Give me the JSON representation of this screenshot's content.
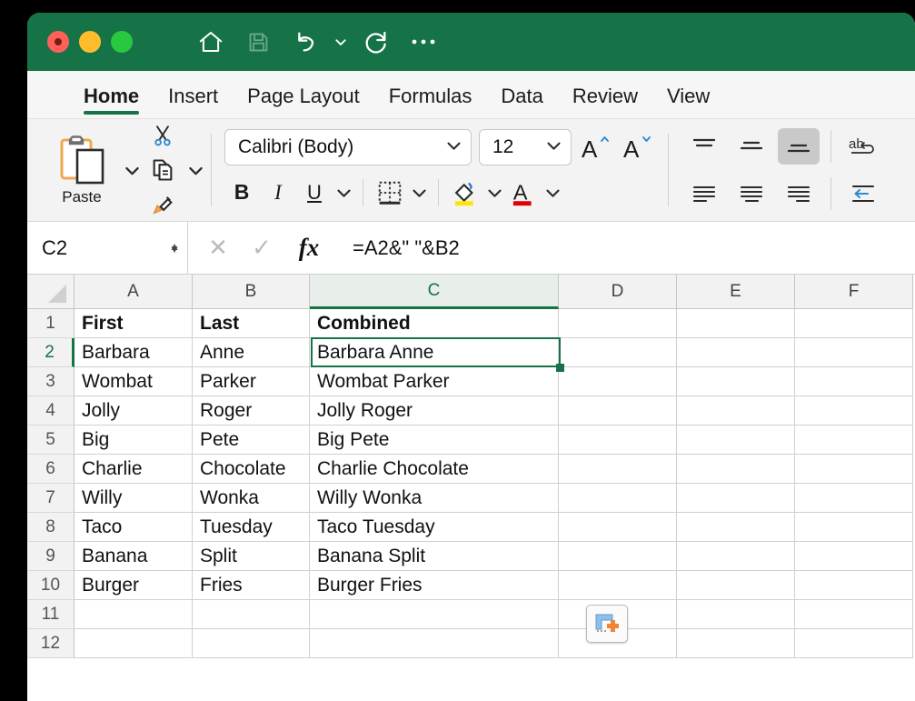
{
  "window": {
    "titlebar_color": "#157347",
    "traffic_lights": [
      "close",
      "minimize",
      "maximize"
    ],
    "quick_access": [
      {
        "name": "home-icon",
        "label": "Home"
      },
      {
        "name": "save-icon",
        "label": "Save"
      },
      {
        "name": "undo-icon",
        "label": "Undo"
      },
      {
        "name": "undo-dropdown-icon",
        "label": "Undo options"
      },
      {
        "name": "redo-icon",
        "label": "Redo"
      },
      {
        "name": "more-options-icon",
        "label": "More"
      }
    ]
  },
  "ribbon": {
    "tabs": [
      {
        "label": "Home",
        "active": true
      },
      {
        "label": "Insert",
        "active": false
      },
      {
        "label": "Page Layout",
        "active": false
      },
      {
        "label": "Formulas",
        "active": false
      },
      {
        "label": "Data",
        "active": false
      },
      {
        "label": "Review",
        "active": false
      },
      {
        "label": "View",
        "active": false
      }
    ],
    "clipboard": {
      "paste_label": "Paste",
      "cut_label": "Cut",
      "copy_label": "Copy",
      "format_painter_label": "Format Painter"
    },
    "font": {
      "family_value": "Calibri (Body)",
      "size_value": "12",
      "bold_label": "B",
      "italic_label": "I",
      "underline_label": "U",
      "grow_font_label": "A",
      "shrink_font_label": "A",
      "borders_label": "Borders",
      "fill_color_label": "Fill Color",
      "fill_color": "#ffe600",
      "font_color_label": "Font Color",
      "font_color": "#e00000"
    },
    "alignment": {
      "top_align_label": "Top Align",
      "middle_align_label": "Middle Align",
      "bottom_align_label": "Bottom Align",
      "bottom_align_selected": true,
      "align_left_label": "Align Left",
      "align_center_label": "Center",
      "align_right_label": "Align Right",
      "wrap_text_label": "Wrap Text",
      "decrease_indent_label": "Decrease Indent"
    }
  },
  "formula_bar": {
    "name_box_value": "C2",
    "cancel_label": "✕",
    "enter_label": "✓",
    "fx_label": "fx",
    "formula_value": "=A2&\" \"&B2"
  },
  "sheet": {
    "column_headers": [
      "A",
      "B",
      "C",
      "D",
      "E",
      "F"
    ],
    "selected_column": "C",
    "row_headers": [
      "1",
      "2",
      "3",
      "4",
      "5",
      "6",
      "7",
      "8",
      "9",
      "10",
      "11",
      "12"
    ],
    "selected_row": "2",
    "selected_cell": "C2",
    "quick_analysis_label": "Paste Options",
    "rows": [
      {
        "num": "1",
        "bold": true,
        "cells": [
          "First",
          "Last",
          "Combined",
          "",
          "",
          ""
        ]
      },
      {
        "num": "2",
        "bold": false,
        "cells": [
          "Barbara",
          "Anne",
          "Barbara Anne",
          "",
          "",
          ""
        ]
      },
      {
        "num": "3",
        "bold": false,
        "cells": [
          "Wombat",
          "Parker",
          "Wombat Parker",
          "",
          "",
          ""
        ]
      },
      {
        "num": "4",
        "bold": false,
        "cells": [
          "Jolly",
          "Roger",
          "Jolly Roger",
          "",
          "",
          ""
        ]
      },
      {
        "num": "5",
        "bold": false,
        "cells": [
          "Big",
          "Pete",
          "Big Pete",
          "",
          "",
          ""
        ]
      },
      {
        "num": "6",
        "bold": false,
        "cells": [
          "Charlie",
          "Chocolate",
          "Charlie Chocolate",
          "",
          "",
          ""
        ]
      },
      {
        "num": "7",
        "bold": false,
        "cells": [
          "Willy",
          "Wonka",
          "Willy Wonka",
          "",
          "",
          ""
        ]
      },
      {
        "num": "8",
        "bold": false,
        "cells": [
          "Taco",
          "Tuesday",
          "Taco Tuesday",
          "",
          "",
          ""
        ]
      },
      {
        "num": "9",
        "bold": false,
        "cells": [
          "Banana",
          "Split",
          "Banana Split",
          "",
          "",
          ""
        ]
      },
      {
        "num": "10",
        "bold": false,
        "cells": [
          "Burger",
          "Fries",
          "Burger Fries",
          "",
          "",
          ""
        ]
      },
      {
        "num": "11",
        "bold": false,
        "cells": [
          "",
          "",
          "",
          "",
          "",
          ""
        ]
      },
      {
        "num": "12",
        "bold": false,
        "cells": [
          "",
          "",
          "",
          "",
          "",
          ""
        ]
      }
    ]
  }
}
